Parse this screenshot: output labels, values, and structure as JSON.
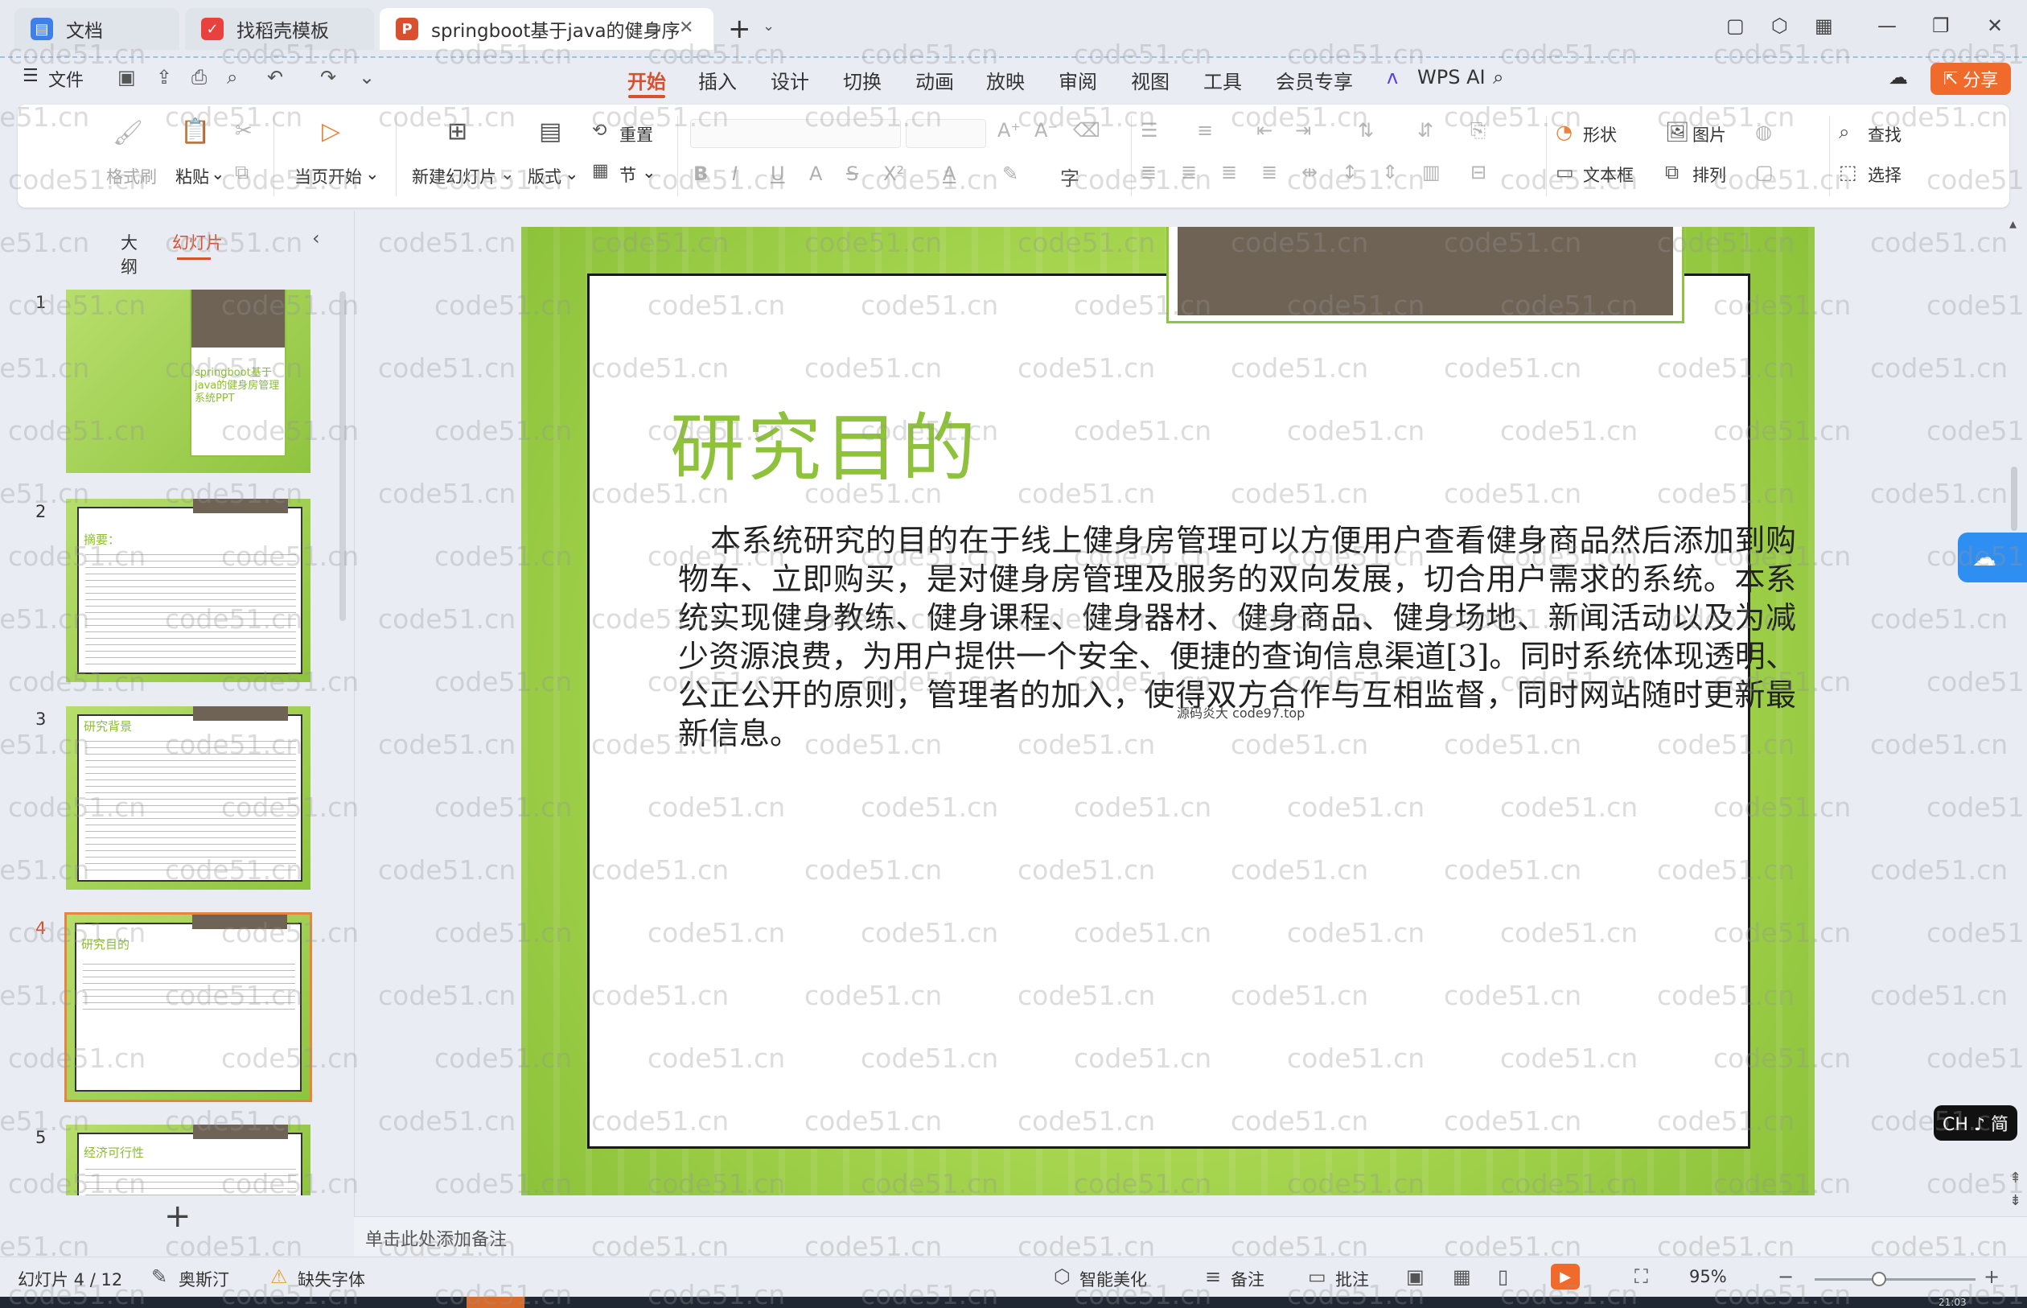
{
  "tabs": [
    {
      "label": "文档",
      "icon": "wps-doc-icon",
      "color": "#3f7fe8"
    },
    {
      "label": "找稻壳模板",
      "icon": "docer-icon",
      "color": "#e8413e"
    },
    {
      "label": "springboot基于java的健身序",
      "icon": "ppt-icon",
      "color": "#d9502e"
    }
  ],
  "menu": {
    "file": "文件",
    "items": [
      "开始",
      "插入",
      "设计",
      "切换",
      "动画",
      "放映",
      "审阅",
      "视图",
      "工具",
      "会员专享"
    ],
    "wps_ai": "WPS AI",
    "share": "分享"
  },
  "ribbon": {
    "format_painter": "格式刷",
    "paste": "粘贴",
    "play_from_current": "当页开始",
    "new_slide": "新建幻灯片",
    "layout": "版式",
    "reset": "重置",
    "section": "节",
    "shape": "形状",
    "picture": "图片",
    "find": "查找",
    "textbox": "文本框",
    "arrange": "排列",
    "select": "选择"
  },
  "left_panel": {
    "outline_tab": "大纲",
    "slides_tab": "幻灯片",
    "thumbnails": [
      {
        "num": "1",
        "title": "springboot基于java的健身房管理系统PPT"
      },
      {
        "num": "2",
        "title": "摘要："
      },
      {
        "num": "3",
        "title": "研究背景"
      },
      {
        "num": "4",
        "title": "研究目的"
      },
      {
        "num": "5",
        "title": "经济可行性"
      }
    ]
  },
  "slide": {
    "title": "研究目的",
    "body": "本系统研究的目的在于线上健身房管理可以方便用户查看健身商品然后添加到购物车、立即购买，是对健身房管理及服务的双向发展，切合用户需求的系统。本系统实现健身教练、健身课程、健身器材、健身商品、健身场地、新闻活动以及为减少资源浪费，为用户提供一个安全、便捷的查询信息渠道[3]。同时系统体现透明、公正公开的原则，管理者的加入，使得双方合作与互相监督，同时网站随时更新最新信息。",
    "stamp": "源码炎大 code97.top"
  },
  "notes_placeholder": "单击此处添加备注",
  "status": {
    "slide_counter": "幻灯片 4 / 12",
    "theme": "奥斯汀",
    "missing_font": "缺失字体",
    "smart_beautify": "智能美化",
    "notes": "备注",
    "comments": "批注",
    "zoom": "95%",
    "zoom_fraction": 0.4
  },
  "ime": "CH ♪ 简",
  "clock": "21:03",
  "watermark": "code51.cn",
  "colors": {
    "accent": "#d9502e",
    "slide_green": "#8dc23a",
    "title_bar": "#6f6356",
    "share": "#f06a2c"
  }
}
